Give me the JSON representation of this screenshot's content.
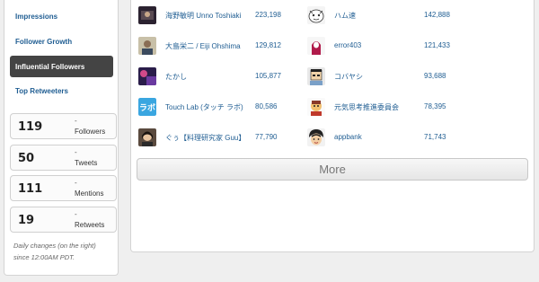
{
  "sidebar": {
    "nav": [
      {
        "label": "Impressions",
        "active": false
      },
      {
        "label": "Follower Growth",
        "active": false
      },
      {
        "label": "Influential Followers",
        "active": true
      },
      {
        "label": "Top Retweeters",
        "active": false
      }
    ],
    "stats": [
      {
        "value": "119",
        "dash": "-",
        "label": "Followers"
      },
      {
        "value": "50",
        "dash": "-",
        "label": "Tweets"
      },
      {
        "value": "111",
        "dash": "-",
        "label": "Mentions"
      },
      {
        "value": "19",
        "dash": "-",
        "label": "Retweets"
      }
    ],
    "note": "Daily changes (on the right) since 12:00AM PDT."
  },
  "followers": [
    {
      "name": "海野敏明 Unno Toshiaki",
      "count": "223,198",
      "avatar": "photo-dark"
    },
    {
      "name": "ハム速",
      "count": "142,888",
      "avatar": "cartoon-face"
    },
    {
      "name": "大島栄二 / Eiji Ohshima",
      "count": "129,812",
      "avatar": "photo-person"
    },
    {
      "name": "error403",
      "count": "121,433",
      "avatar": "ghost-figure"
    },
    {
      "name": "たかし",
      "count": "105,877",
      "avatar": "photo-purple"
    },
    {
      "name": "コバヤシ",
      "count": "93,688",
      "avatar": "pixel-face"
    },
    {
      "name": "Touch Lab (タッチ ラボ)",
      "count": "80,586",
      "avatar": "rabo-logo"
    },
    {
      "name": "元気思考推進委員会",
      "count": "78,395",
      "avatar": "cartoon-yellow"
    },
    {
      "name": "ぐぅ【料理研究家 Guu】",
      "count": "77,790",
      "avatar": "photo-woman"
    },
    {
      "name": "appbank",
      "count": "71,743",
      "avatar": "appbank-face"
    }
  ],
  "more_label": "More",
  "colors": {
    "link": "#1f5d92",
    "active_nav_bg": "#444444",
    "rabo_blue": "#3aa6e0"
  },
  "rabo_text": "ラボ"
}
